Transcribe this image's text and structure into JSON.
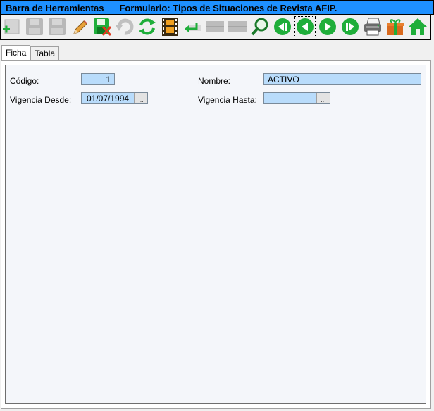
{
  "title": {
    "toolbar_label": "Barra de Herramientas",
    "form_label": "Formulario: Tipos de Situaciones de Revista AFIP."
  },
  "toolbar": {
    "buttons": [
      {
        "icon": "add-icon",
        "enabled": true
      },
      {
        "icon": "save-icon",
        "enabled": false
      },
      {
        "icon": "save-as-icon",
        "enabled": false
      },
      {
        "icon": "edit-pencil-icon",
        "enabled": true
      },
      {
        "icon": "delete-icon",
        "enabled": true
      },
      {
        "icon": "undo-icon",
        "enabled": false
      },
      {
        "icon": "refresh-icon",
        "enabled": true
      },
      {
        "icon": "filmstrip-icon",
        "enabled": true
      },
      {
        "icon": "enter-arrow-icon",
        "enabled": true
      },
      {
        "icon": "blank-button-icon",
        "enabled": false
      },
      {
        "icon": "blank-button-icon",
        "enabled": false
      },
      {
        "icon": "search-icon",
        "enabled": true
      },
      {
        "icon": "first-record-icon",
        "enabled": true
      },
      {
        "icon": "previous-record-icon",
        "enabled": true
      },
      {
        "icon": "next-record-icon",
        "enabled": true
      },
      {
        "icon": "last-record-icon",
        "enabled": true
      },
      {
        "icon": "printer-icon",
        "enabled": true
      },
      {
        "icon": "gift-icon",
        "enabled": true
      },
      {
        "icon": "home-icon",
        "enabled": true
      }
    ]
  },
  "tabs": [
    {
      "label": "Ficha",
      "active": true
    },
    {
      "label": "Tabla",
      "active": false
    }
  ],
  "form": {
    "codigo_label": "Código:",
    "codigo_value": "1",
    "nombre_label": "Nombre:",
    "nombre_value": "ACTIVO",
    "vig_desde_label": "Vigencia Desde:",
    "vig_desde_value": "01/07/1994",
    "vig_hasta_label": "Vigencia Hasta:",
    "vig_hasta_value": "",
    "date_button": "..."
  },
  "colors": {
    "title_bg": "#1e90ff",
    "field_bg": "#b9dcfb",
    "green": "#1fae3a"
  }
}
